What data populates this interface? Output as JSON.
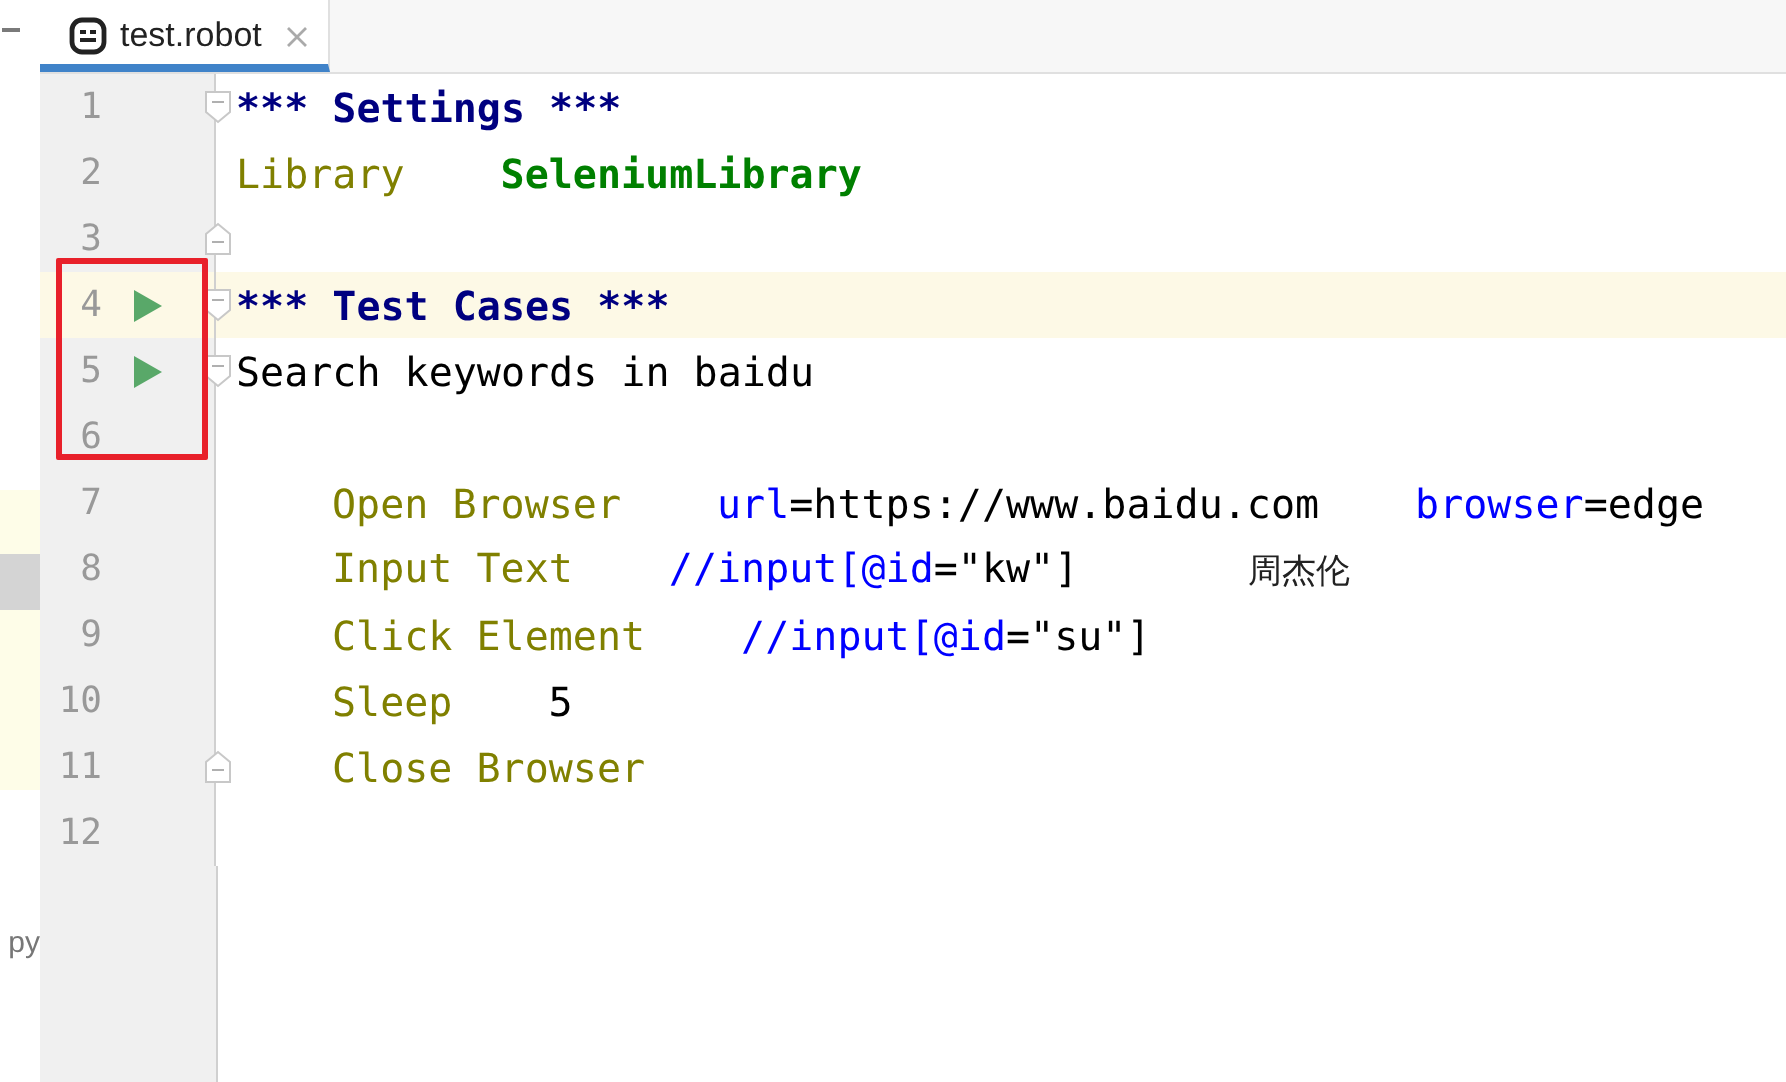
{
  "side_panel": {
    "items": [
      {
        "kind": "dash"
      },
      {
        "kind": "row",
        "selected": false
      },
      {
        "kind": "row",
        "selected": true
      },
      {
        "kind": "row",
        "selected": false
      },
      {
        "kind": "text",
        "text": "py"
      }
    ]
  },
  "tabs": [
    {
      "label": "test.robot",
      "selected": true
    }
  ],
  "editor": {
    "lines": [
      {
        "number": "1",
        "kind": "header",
        "fold_start": true,
        "fold_end": false,
        "run": false,
        "current": false,
        "cells": [
          [
            {
              "kind": "header",
              "text": "*** Settings ***"
            }
          ]
        ]
      },
      {
        "number": "2",
        "kind": "setting",
        "fold_start": false,
        "fold_end": false,
        "run": false,
        "current": false,
        "cells": [
          [
            {
              "kind": "setting",
              "text": "Library"
            }
          ],
          [
            {
              "kind": "library",
              "text": "SeleniumLibrary"
            }
          ]
        ]
      },
      {
        "number": "3",
        "kind": "blank",
        "fold_start": false,
        "fold_end": true,
        "run": false,
        "current": false
      },
      {
        "number": "4",
        "kind": "header",
        "fold_start": true,
        "fold_end": false,
        "run": true,
        "current": true,
        "cells": [
          [
            {
              "kind": "header",
              "text": "*** Test Cases ***"
            }
          ]
        ]
      },
      {
        "number": "5",
        "kind": "testcase",
        "fold_start": true,
        "fold_end": false,
        "run": true,
        "current": false,
        "cells": [
          [
            {
              "kind": "plain",
              "text": "Search keywords in baidu"
            }
          ]
        ]
      },
      {
        "number": "6",
        "kind": "blank",
        "fold_start": false,
        "fold_end": false,
        "run": false,
        "current": false
      },
      {
        "number": "7",
        "kind": "step",
        "fold_start": false,
        "fold_end": false,
        "run": false,
        "current": false,
        "cells": [
          [
            {
              "kind": "keyword",
              "text": "Open Browser"
            }
          ],
          [
            {
              "kind": "locator",
              "text": "url"
            },
            {
              "kind": "plain",
              "text": "=https://www.baidu.com"
            }
          ],
          [
            {
              "kind": "locator",
              "text": "browser"
            },
            {
              "kind": "plain",
              "text": "=edge"
            }
          ]
        ]
      },
      {
        "number": "8",
        "kind": "step",
        "fold_start": false,
        "fold_end": false,
        "run": false,
        "current": false,
        "cells": [
          [
            {
              "kind": "keyword",
              "text": "Input Text"
            }
          ],
          [
            {
              "kind": "locator",
              "text": "//input[@id"
            },
            {
              "kind": "plain",
              "text": "=\"kw\"]"
            }
          ],
          [
            {
              "kind": "cjk",
              "text": "周杰伦"
            }
          ]
        ]
      },
      {
        "number": "9",
        "kind": "step",
        "fold_start": false,
        "fold_end": false,
        "run": false,
        "current": false,
        "cells": [
          [
            {
              "kind": "keyword",
              "text": "Click Element"
            }
          ],
          [
            {
              "kind": "locator",
              "text": "//input[@id"
            },
            {
              "kind": "plain",
              "text": "=\"su\"]"
            }
          ]
        ]
      },
      {
        "number": "10",
        "kind": "step",
        "fold_start": false,
        "fold_end": false,
        "run": false,
        "current": false,
        "cells": [
          [
            {
              "kind": "keyword",
              "text": "Sleep"
            }
          ],
          [
            {
              "kind": "plain",
              "text": "5"
            }
          ]
        ]
      },
      {
        "number": "11",
        "kind": "step",
        "fold_start": false,
        "fold_end": true,
        "run": false,
        "current": false,
        "cells": [
          [
            {
              "kind": "keyword",
              "text": "Close Browser"
            }
          ]
        ]
      },
      {
        "number": "12",
        "kind": "blank",
        "fold_start": false,
        "fold_end": false,
        "run": false,
        "current": false
      }
    ]
  }
}
